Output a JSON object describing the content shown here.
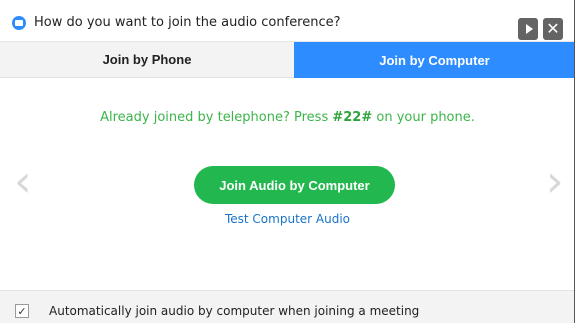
{
  "window": {
    "title": "How do you want to join the audio conference?",
    "icons": {
      "app": "zoom-camera-icon",
      "play": "play-icon",
      "close": "close-icon"
    },
    "close_glyph": "✕",
    "play_glyph": ""
  },
  "tabs": [
    {
      "label": "Join by Phone",
      "active": false
    },
    {
      "label": "Join by Computer",
      "active": true
    }
  ],
  "notice": {
    "prefix": "Already joined by telephone? Press ",
    "code": "#22#",
    "suffix": " on your phone."
  },
  "nav": {
    "left": "‹",
    "right": "›"
  },
  "primary_button": {
    "label": "Join Audio by Computer"
  },
  "test_link": {
    "label": "Test Computer Audio"
  },
  "footer": {
    "checkbox_checked": true,
    "check_glyph": "✓",
    "label": "Automatically join audio by computer when joining a meeting"
  },
  "colors": {
    "accent_blue": "#2d8cff",
    "join_green": "#23b84f",
    "notice_green": "#3bb54a",
    "link_blue": "#1a73c8"
  }
}
